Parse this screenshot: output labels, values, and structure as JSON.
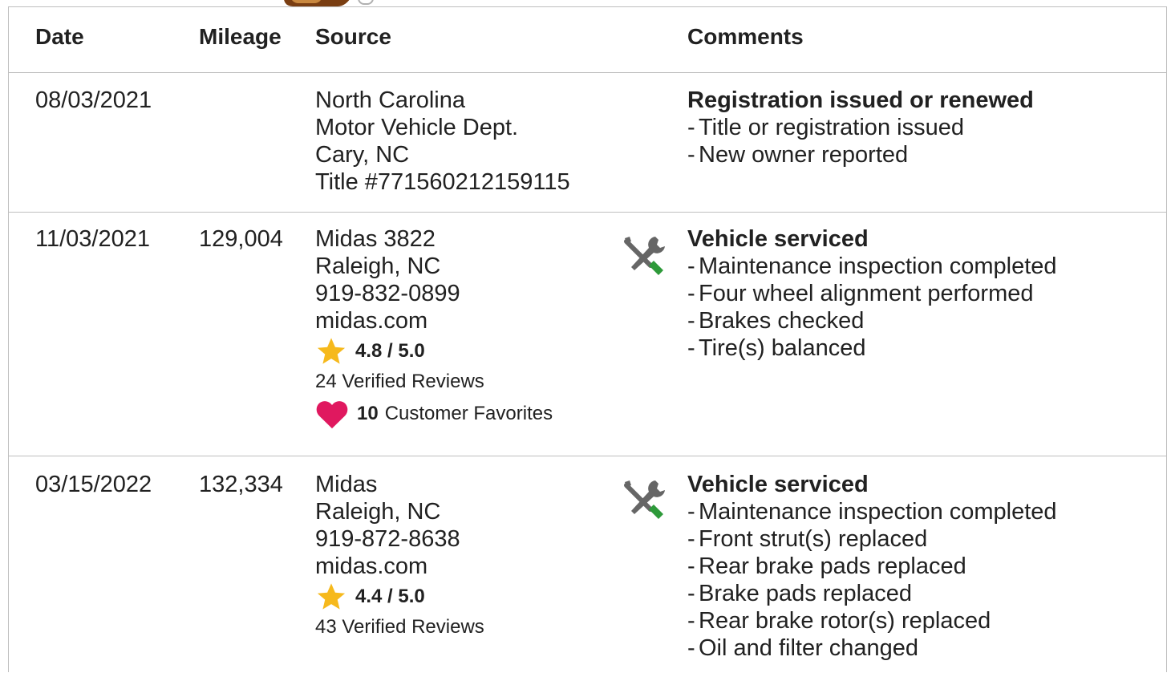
{
  "colors": {
    "border": "#bfbfbf",
    "text": "#212121",
    "star": "#f6b91c",
    "heart": "#e0185f",
    "wrench_green": "#2e9a3a",
    "wrench_gray": "#666666"
  },
  "header": {
    "date": "Date",
    "mileage": "Mileage",
    "source": "Source",
    "comments": "Comments"
  },
  "rows": [
    {
      "date": "08/03/2021",
      "mileage": "",
      "source": [
        "North Carolina",
        "Motor Vehicle Dept.",
        "Cary, NC",
        "Title #771560212159115"
      ],
      "icon": "",
      "comment_title": "Registration issued or renewed",
      "comments": [
        "Title or registration issued",
        "New owner reported"
      ]
    },
    {
      "date": "11/03/2021",
      "mileage": "129,004",
      "source": [
        "Midas 3822",
        "Raleigh, NC",
        "919-832-0899",
        "midas.com"
      ],
      "rating": "4.8 / 5.0",
      "reviews": "24 Verified Reviews",
      "favorites_count": "10",
      "favorites_label": "Customer Favorites",
      "icon": "wrench-screwdriver-icon",
      "comment_title": "Vehicle serviced",
      "comments": [
        "Maintenance inspection completed",
        "Four wheel alignment performed",
        "Brakes checked",
        "Tire(s) balanced"
      ]
    },
    {
      "date": "03/15/2022",
      "mileage": "132,334",
      "source": [
        "Midas",
        "Raleigh, NC",
        "919-872-8638",
        "midas.com"
      ],
      "rating": "4.4 / 5.0",
      "reviews": "43 Verified Reviews",
      "icon": "wrench-screwdriver-icon",
      "comment_title": "Vehicle serviced",
      "comments": [
        "Maintenance inspection completed",
        "Front strut(s) replaced",
        "Rear brake pads replaced",
        "Brake pads replaced",
        "Rear brake rotor(s) replaced",
        "Oil and filter changed"
      ]
    }
  ],
  "dash": "-"
}
